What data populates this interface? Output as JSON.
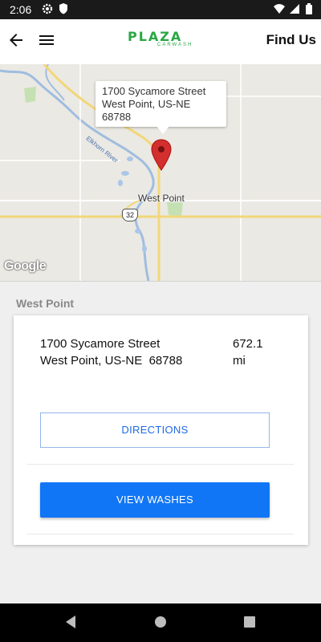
{
  "status_bar": {
    "time": "2:06"
  },
  "header": {
    "logo_main": "PLAZA",
    "logo_sub": "CARWASH",
    "title": "Find Us"
  },
  "map": {
    "callout_line1": "1700 Sycamore Street",
    "callout_line2": "West Point, US-NE",
    "callout_line3": "68788",
    "town_label": "West Point",
    "river_label": "Elkhorn River",
    "highway_number": "32",
    "attribution": "Google"
  },
  "location": {
    "section_title": "West Point",
    "address_line1": "1700 Sycamore Street",
    "address_line2": "West Point, US-NE  68788",
    "distance_value": "672.1",
    "distance_unit": "mi",
    "directions_label": "DIRECTIONS",
    "view_washes_label": "VIEW WASHES"
  },
  "colors": {
    "brand_green": "#29a743",
    "accent_blue": "#1176f5",
    "pin_red": "#d32f2f"
  }
}
